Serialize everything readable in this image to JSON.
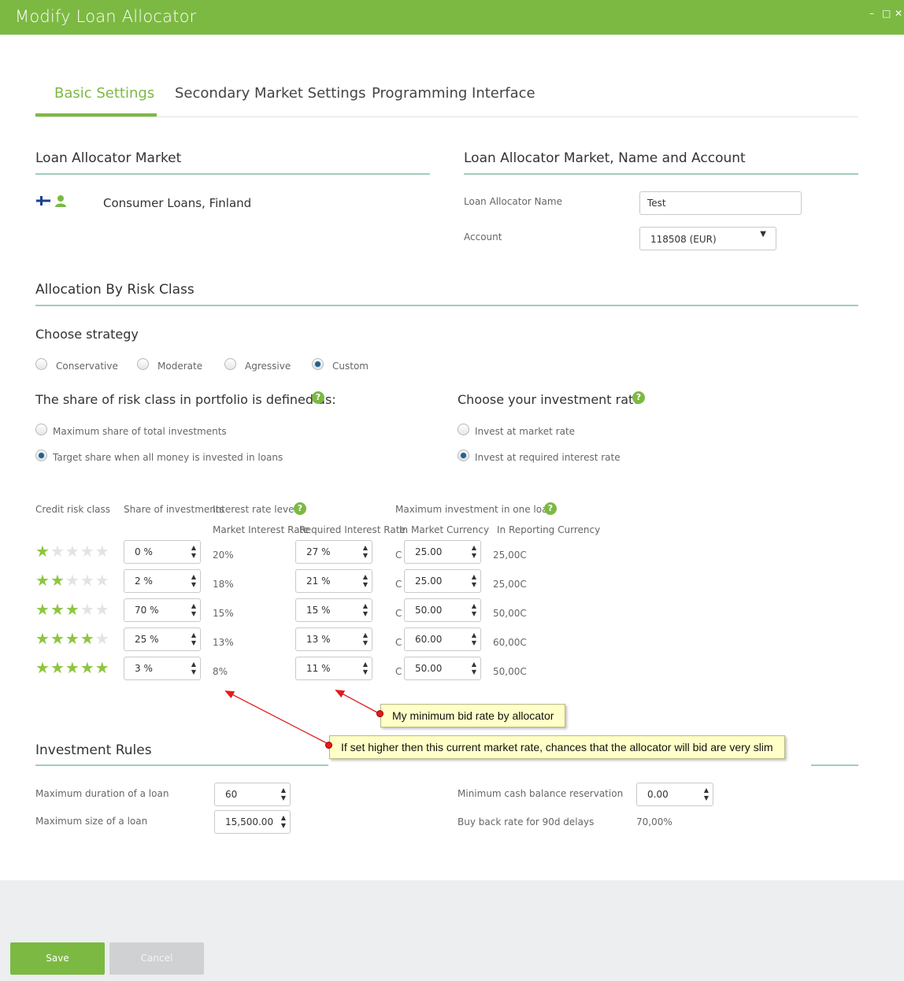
{
  "window": {
    "title": "Modify Loan Allocator",
    "controls": [
      "–",
      "□",
      "✕"
    ]
  },
  "tabs": [
    {
      "label": "Basic Settings",
      "active": true
    },
    {
      "label": "Secondary Market Settings",
      "active": false
    },
    {
      "label": "Programming Interface",
      "active": false
    }
  ],
  "market": {
    "heading": "Loan Allocator Market",
    "name": "Consumer Loans, Finland",
    "icons": [
      "finland-flag-icon",
      "person-icon"
    ]
  },
  "name_account": {
    "heading": "Loan Allocator Market, Name and Account",
    "name_label": "Loan Allocator Name",
    "name_value": "Test",
    "account_label": "Account",
    "account_value": "118508 (EUR)"
  },
  "allocation": {
    "heading": "Allocation By Risk Class",
    "strategy_label": "Choose strategy",
    "strategies": [
      {
        "label": "Conservative",
        "selected": false
      },
      {
        "label": "Moderate",
        "selected": false
      },
      {
        "label": "Agressive",
        "selected": false
      },
      {
        "label": "Custom",
        "selected": true
      }
    ],
    "share_heading": "The share of risk class in portfolio is defined as:",
    "share_options": [
      {
        "label": "Maximum share of total investments",
        "selected": false
      },
      {
        "label": "Target share when all money is invested in loans",
        "selected": true
      }
    ],
    "rate_heading": "Choose your investment rate",
    "rate_options": [
      {
        "label": "Invest at market rate",
        "selected": false
      },
      {
        "label": "Invest at required interest rate",
        "selected": true
      }
    ],
    "help_symbol": "?"
  },
  "table": {
    "headers": {
      "credit_risk_class": "Credit risk class",
      "share": "Share of investments",
      "interest_rate_level": "Interest rate level",
      "market_rate": "Market Interest Rate",
      "required_rate": "Required Interest Rate",
      "max_investment": "Maximum investment in one loan",
      "market_currency": "In Market Currency",
      "reporting_currency": "In Reporting Currency"
    },
    "currency_symbol": "C",
    "rows": [
      {
        "stars": 1,
        "share": "0 %",
        "market_rate": "20%",
        "required_rate": "27 %",
        "market_currency": "25.00",
        "reporting_currency": "25,00C"
      },
      {
        "stars": 2,
        "share": "2 %",
        "market_rate": "18%",
        "required_rate": "21 %",
        "market_currency": "25.00",
        "reporting_currency": "25,00C"
      },
      {
        "stars": 3,
        "share": "70 %",
        "market_rate": "15%",
        "required_rate": "15 %",
        "market_currency": "50.00",
        "reporting_currency": "50,00C"
      },
      {
        "stars": 4,
        "share": "25 %",
        "market_rate": "13%",
        "required_rate": "13 %",
        "market_currency": "60.00",
        "reporting_currency": "60,00C"
      },
      {
        "stars": 5,
        "share": "3 %",
        "market_rate": "8%",
        "required_rate": "11 %",
        "market_currency": "50.00",
        "reporting_currency": "50,00C"
      }
    ]
  },
  "annotations": {
    "callout_required": "My minimum bid rate by allocator",
    "callout_market": "If set higher then this current market rate, chances that the allocator will bid are very slim"
  },
  "rules": {
    "heading": "Investment Rules",
    "max_duration_label": "Maximum duration of a loan",
    "max_duration_value": "60",
    "max_size_label": "Maximum size of a loan",
    "max_size_value": "15,500.00",
    "min_cash_label": "Minimum cash balance reservation",
    "min_cash_value": "0.00",
    "buyback_label": "Buy back rate for 90d delays",
    "buyback_value": "70,00%"
  },
  "footer": {
    "save_label": "Save",
    "cancel_label": "Cancel"
  },
  "colors": {
    "brand_green": "#7cb942",
    "rule_teal": "#9fcfb8",
    "callout_bg": "#ffffc8",
    "arrow_red": "#e21b1b"
  }
}
